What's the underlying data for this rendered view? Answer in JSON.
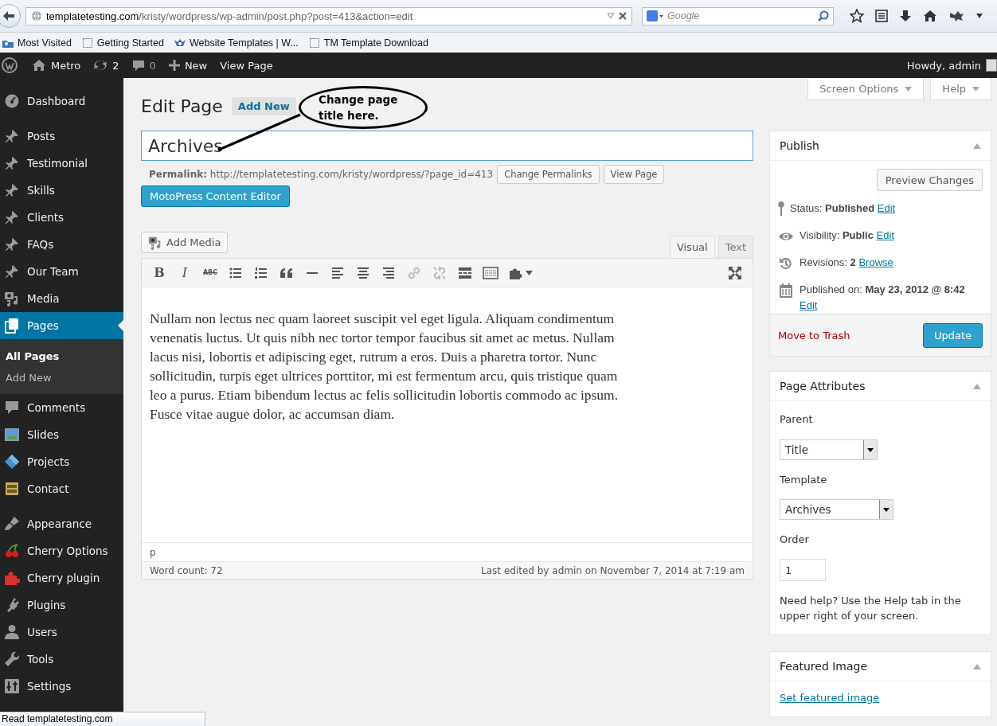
{
  "browser": {
    "host": "templatetesting.com",
    "path": "/kristy/wordpress/wp-admin/post.php?post=413&action=edit",
    "search_placeholder": "Google",
    "bookmarks": [
      {
        "kind": "folder",
        "label": "Most Visited"
      },
      {
        "kind": "page",
        "label": "Getting Started"
      },
      {
        "kind": "site",
        "label": "Website Templates | W..."
      },
      {
        "kind": "page",
        "label": "TM Template Download"
      }
    ]
  },
  "admin_bar": {
    "site": "Metro",
    "updates": "2",
    "comments": "0",
    "new": "New",
    "view_page": "View Page",
    "greeting": "Howdy, admin"
  },
  "sidebar": {
    "groups": [
      [
        {
          "kind": "dashboard",
          "label": "Dashboard",
          "selected": false
        }
      ],
      [
        {
          "kind": "pin",
          "label": "Posts",
          "selected": false
        },
        {
          "kind": "pin",
          "label": "Testimonial",
          "selected": false
        },
        {
          "kind": "pin",
          "label": "Skills",
          "selected": false
        },
        {
          "kind": "pin",
          "label": "Clients",
          "selected": false
        },
        {
          "kind": "pin",
          "label": "FAQs",
          "selected": false
        },
        {
          "kind": "pin",
          "label": "Our Team",
          "selected": false
        },
        {
          "kind": "media",
          "label": "Media",
          "selected": false
        },
        {
          "kind": "pages",
          "label": "Pages",
          "selected": true,
          "children": [
            {
              "label": "All Pages",
              "selected": true
            },
            {
              "label": "Add New",
              "selected": false
            }
          ]
        },
        {
          "kind": "comments",
          "label": "Comments",
          "selected": false
        },
        {
          "kind": "slides",
          "label": "Slides",
          "selected": false
        },
        {
          "kind": "projects",
          "label": "Projects",
          "selected": false
        },
        {
          "kind": "contact",
          "label": "Contact",
          "selected": false
        }
      ],
      [
        {
          "kind": "appearance",
          "label": "Appearance",
          "selected": false
        },
        {
          "kind": "cherry",
          "label": "Cherry Options",
          "selected": false
        },
        {
          "kind": "puzzle",
          "label": "Cherry plugin",
          "selected": false
        },
        {
          "kind": "plugins",
          "label": "Plugins",
          "selected": false
        },
        {
          "kind": "users",
          "label": "Users",
          "selected": false
        },
        {
          "kind": "tools",
          "label": "Tools",
          "selected": false
        },
        {
          "kind": "settings",
          "label": "Settings",
          "selected": false
        }
      ]
    ]
  },
  "screen_meta": [
    "Screen Options",
    "Help"
  ],
  "page": {
    "heading": "Edit Page",
    "add_new": "Add New",
    "title_value": "Archives",
    "permalink_label": "Permalink:",
    "permalink_url": "http://templatetesting.com/kristy/wordpress/?page_id=413",
    "permalink_buttons": [
      "Change Permalinks",
      "View Page"
    ],
    "builder_button": "MotoPress Content Editor",
    "add_media": "Add Media",
    "editor_tabs": [
      {
        "label": "Visual",
        "selected": true
      },
      {
        "label": "Text",
        "selected": false
      }
    ],
    "toolbar": [
      {
        "kind": "bold",
        "glyph": "B",
        "disabled": false
      },
      {
        "kind": "italic",
        "glyph": "I",
        "disabled": false
      },
      {
        "kind": "strikethrough",
        "glyph": "ABC",
        "disabled": false
      },
      {
        "kind": "bullet-list",
        "disabled": false
      },
      {
        "kind": "numbered-list",
        "disabled": false
      },
      {
        "kind": "blockquote",
        "disabled": false
      },
      {
        "kind": "horizontal-rule",
        "disabled": false
      },
      {
        "kind": "align-left",
        "disabled": false
      },
      {
        "kind": "align-center",
        "disabled": false
      },
      {
        "kind": "align-right",
        "disabled": false
      },
      {
        "kind": "link",
        "disabled": true
      },
      {
        "kind": "unlink",
        "disabled": true
      },
      {
        "kind": "more",
        "disabled": false
      },
      {
        "kind": "toolbar-toggle",
        "disabled": false
      },
      {
        "kind": "plugin",
        "disabled": false
      },
      {
        "kind": "fullscreen",
        "disabled": false
      }
    ],
    "content": "Nullam non lectus nec quam laoreet suscipit vel eget ligula. Aliquam condimentum venenatis luctus. Ut quis nibh nec tortor tempor faucibus sit amet ac metus. Nullam lacus nisi, lobortis et adipiscing eget, rutrum a eros. Duis a pharetra tortor. Nunc sollicitudin, turpis eget ultrices porttitor, mi est fermentum arcu, quis tristique quam leo a purus. Etiam bibendum lectus ac felis sollicitudin lobortis commodo ac ipsum. Fusce vitae augue dolor, ac accumsan diam.",
    "path": "p",
    "word_count": "Word count: 72",
    "last_edited": "Last edited by admin on November 7, 2014 at 7:19 am"
  },
  "annotation": {
    "text": "Change page title here."
  },
  "publish": {
    "title": "Publish",
    "preview": "Preview Changes",
    "rows": [
      {
        "kind": "status",
        "text": "Status: **Published**",
        "link": "Edit"
      },
      {
        "kind": "visibility",
        "text": "Visibility: **Public**",
        "link": "Edit"
      },
      {
        "kind": "revisions",
        "text": "Revisions: **2**",
        "link": "Browse"
      },
      {
        "kind": "published",
        "text": "Published on: **May 23, 2012 @ 8:42**",
        "link": "Edit"
      }
    ],
    "trash": "Move to Trash",
    "update": "Update"
  },
  "page_attributes": {
    "title": "Page Attributes",
    "parent_label": "Parent",
    "parent_value": "Title",
    "template_label": "Template",
    "template_value": "Archives",
    "order_label": "Order",
    "order_value": "1",
    "help": "Need help? Use the Help tab in the upper right of your screen."
  },
  "featured_image": {
    "title": "Featured Image",
    "link": "Set featured image"
  },
  "status_tip": "Read templatetesting.com"
}
